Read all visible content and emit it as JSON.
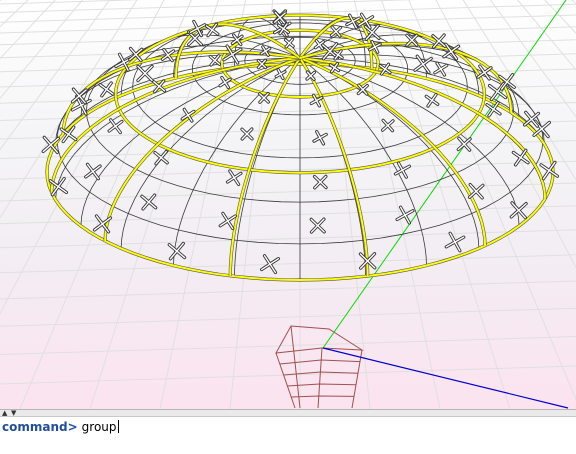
{
  "colors": {
    "grid": "#e0e0e0",
    "dome_edges": "#ffff00",
    "wire": "#3a3a3a",
    "cage": "#a05050",
    "axis_y": "#00dd00",
    "axis_x": "#0000cc",
    "prompt": "#1f4e9e"
  },
  "splitter": {
    "arrow_up_icon": "triangle-up",
    "arrow_down_icon": "triangle-down"
  },
  "command": {
    "prompt": "command>",
    "value": "group"
  }
}
